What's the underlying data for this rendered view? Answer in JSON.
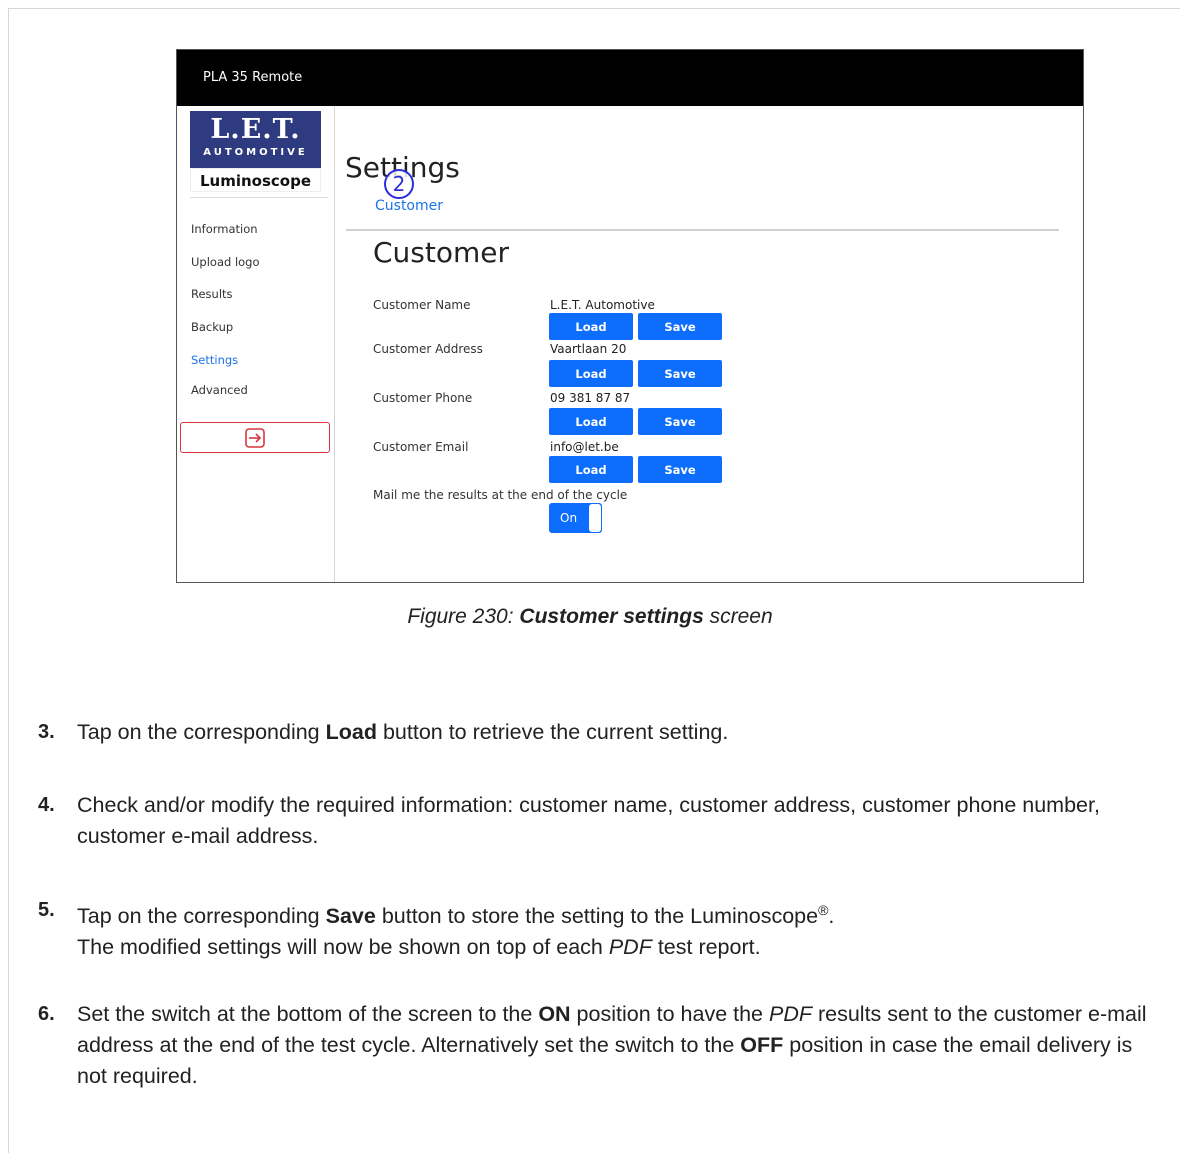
{
  "screenshot": {
    "window_title": "PLA 35 Remote",
    "logo": {
      "line1": "L.E.T.",
      "line2": "AUTOMOTIVE",
      "line3": "Luminoscope"
    },
    "nav": [
      "Information",
      "Upload logo",
      "Results",
      "Backup",
      "Settings",
      "Advanced"
    ],
    "page_title": "Settings",
    "breadcrumb": "Customer",
    "callout": "2",
    "section_title": "Customer",
    "fields": [
      {
        "label": "Customer Name",
        "value": "L.E.T. Automotive"
      },
      {
        "label": "Customer Address",
        "value": "Vaartlaan 20"
      },
      {
        "label": "Customer Phone",
        "value": "09 381 87 87"
      },
      {
        "label": "Customer Email",
        "value": "info@let.be"
      }
    ],
    "load_label": "Load",
    "save_label": "Save",
    "mail_label": "Mail me the results at the end of the cycle",
    "toggle_label": "On",
    "accent_color": "#0d6efd",
    "logout_icon": "logout-icon"
  },
  "caption": {
    "prefix": "Figure 230: ",
    "bold": "Customer settings",
    "suffix": " screen"
  },
  "steps": [
    {
      "num": "3.",
      "parts": [
        "Tap on the corresponding ",
        "Load",
        " button to retrieve the current setting."
      ]
    },
    {
      "num": "4.",
      "text": "Check and/or modify the required information: customer name, customer address, customer phone number, customer e-mail address."
    },
    {
      "num": "5.",
      "parts": [
        "Tap on the corresponding ",
        "Save",
        " button to store the setting to the Luminoscope",
        "®",
        "."
      ],
      "line2_a": "The modified settings will now be shown on top of each ",
      "line2_b": "PDF",
      "line2_c": " test report."
    },
    {
      "num": "6.",
      "parts": [
        "Set the switch at the bottom of the screen to the ",
        "ON",
        " position to have the ",
        "PDF",
        " results sent to the customer e-mail address at the end of the test cycle. Alternatively set the switch to the ",
        "OFF",
        " position in case the email delivery is not required."
      ]
    }
  ]
}
